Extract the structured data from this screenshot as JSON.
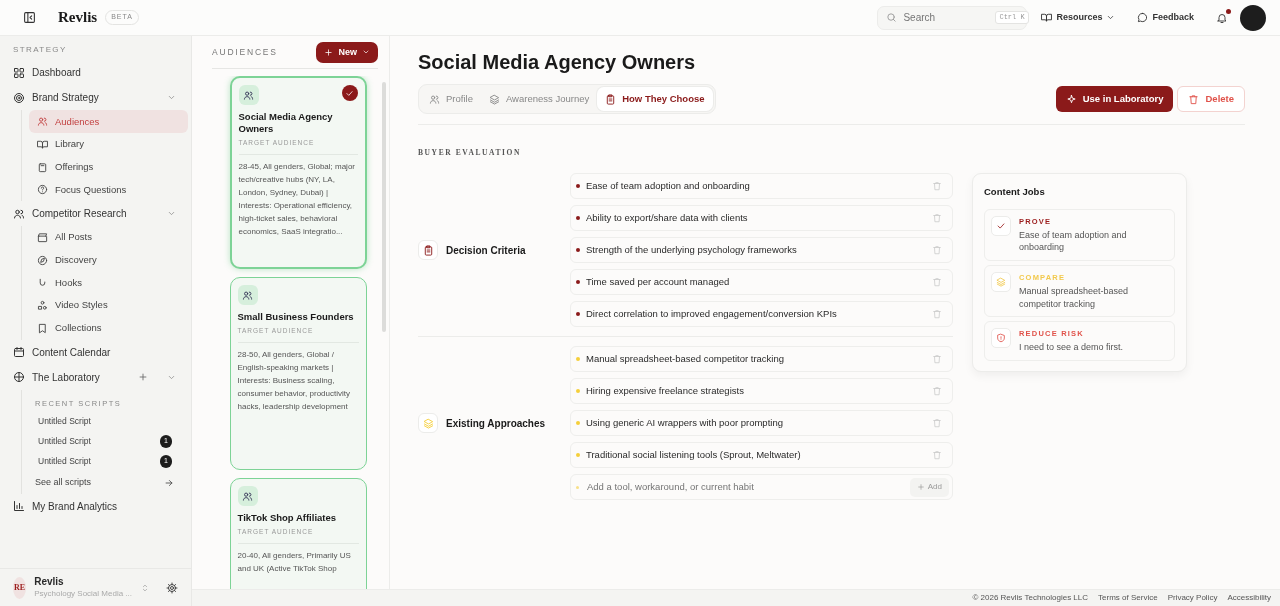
{
  "app": {
    "name": "Revlis",
    "badge": "BETA"
  },
  "header": {
    "search_placeholder": "Search",
    "search_shortcut": "Ctrl K",
    "resources": "Resources",
    "feedback": "Feedback",
    "has_notification": true
  },
  "sidebar": {
    "section_label": "STRATEGY",
    "items": [
      {
        "label": "Dashboard",
        "kind": "link",
        "selected": false
      },
      {
        "label": "Brand Strategy",
        "kind": "group",
        "expanded": true,
        "children": [
          {
            "label": "Audiences",
            "selected": true
          },
          {
            "label": "Library",
            "selected": false
          },
          {
            "label": "Offerings",
            "selected": false
          },
          {
            "label": "Focus Questions",
            "selected": false
          }
        ]
      },
      {
        "label": "Competitor Research",
        "kind": "group",
        "expanded": true,
        "children": [
          {
            "label": "All Posts",
            "selected": false
          },
          {
            "label": "Discovery",
            "selected": false
          },
          {
            "label": "Hooks",
            "selected": false
          },
          {
            "label": "Video Styles",
            "selected": false
          },
          {
            "label": "Collections",
            "selected": false
          }
        ]
      },
      {
        "label": "Content Calendar",
        "kind": "link",
        "selected": false
      },
      {
        "label": "The Laboratory",
        "kind": "lab",
        "expanded": true,
        "recent_label": "RECENT SCRIPTS",
        "scripts": [
          {
            "label": "Untitled Script"
          },
          {
            "label": "Untitled Script",
            "count": "1"
          },
          {
            "label": "Untitled Script",
            "count": "1"
          }
        ],
        "see_all": "See all scripts"
      },
      {
        "label": "My Brand Analytics",
        "kind": "link",
        "selected": false
      }
    ],
    "account": {
      "initials": "RE",
      "name": "Revlis",
      "subtitle": "Psychology Social Media ..."
    }
  },
  "audiences": {
    "title": "AUDIENCES",
    "new_button": "New",
    "cards": [
      {
        "name": "Social Media Agency Owners",
        "subtitle": "TARGET AUDIENCE",
        "description": "28-45, All genders, Global; major tech/creative hubs (NY, LA, London, Sydney, Dubai) | Interests: Operational efficiency, high-ticket sales, behavioral economics, SaaS integratio...",
        "selected": true
      },
      {
        "name": "Small Business Founders",
        "subtitle": "TARGET AUDIENCE",
        "description": "28-50, All genders, Global / English-speaking markets | Interests: Business scaling, consumer behavior, productivity hacks, leadership development",
        "selected": false
      },
      {
        "name": "TikTok Shop Affiliates",
        "subtitle": "TARGET AUDIENCE",
        "description": "20-40, All genders, Primarily US and UK (Active TikTok Shop",
        "selected": false
      }
    ]
  },
  "main": {
    "title": "Social Media Agency Owners",
    "tabs": [
      {
        "label": "Profile",
        "selected": false
      },
      {
        "label": "Awareness Journey",
        "selected": false
      },
      {
        "label": "How They Choose",
        "selected": true
      }
    ],
    "use_button": "Use in Laboratory",
    "delete_button": "Delete",
    "section_label": "BUYER EVALUATION",
    "groups": [
      {
        "title": "Decision Criteria",
        "color": "#8b1a1a",
        "items": [
          "Ease of team adoption and onboarding",
          "Ability to export/share data with clients",
          "Strength of the underlying psychology frameworks",
          "Time saved per account managed",
          "Direct correlation to improved engagement/conversion KPIs"
        ]
      },
      {
        "title": "Existing Approaches",
        "color": "#f5cf3a",
        "items": [
          "Manual spreadsheet-based competitor tracking",
          "Hiring expensive freelance strategists",
          "Using generic AI wrappers with poor prompting",
          "Traditional social listening tools (Sprout, Meltwater)"
        ],
        "add_placeholder": "Add a tool, workaround, or current habit",
        "add_button": "Add"
      }
    ],
    "content_jobs": {
      "title": "Content Jobs",
      "jobs": [
        {
          "kind": "prove",
          "label": "PROVE",
          "text": "Ease of team adoption and onboarding",
          "color": "#9b1c1c"
        },
        {
          "kind": "compare",
          "label": "COMPARE",
          "text": "Manual spreadsheet-based competitor tracking",
          "color": "#f2c94c"
        },
        {
          "kind": "risk",
          "label": "REDUCE RISK",
          "text": "I need to see a demo first.",
          "color": "#e0524a"
        }
      ]
    }
  },
  "footer": {
    "copyright": "© 2026 Revlis Technologies LLC",
    "links": [
      "Terms of Service",
      "Privacy Policy",
      "Accessibility"
    ]
  }
}
